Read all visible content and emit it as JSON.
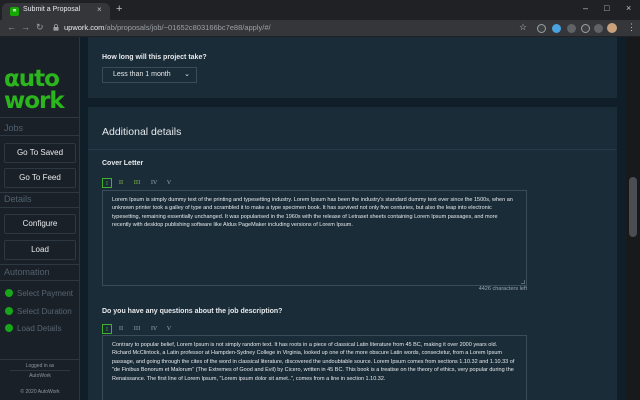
{
  "browser": {
    "tab_title": "Submit a Proposal",
    "tab_close": "×",
    "new_tab": "+",
    "url_host": "upwork.com",
    "url_path": "/ab/proposals/job/~01652c803166bc7e88/apply/#/",
    "window_minimize": "–",
    "window_maximize": "□",
    "window_close": "×"
  },
  "sidebar": {
    "logo_line1": "αuto",
    "logo_line2": "work",
    "section_jobs": "Jobs",
    "go_to_saved": "Go To Saved",
    "go_to_feed": "Go To Feed",
    "section_details": "Details",
    "configure": "Configure",
    "load": "Load",
    "section_automation": "Automation",
    "automation_items": [
      "Select Payment",
      "Select Duration",
      "Load Details"
    ],
    "logged_in_as": "Logged in as",
    "username": "AutoWork",
    "copyright": "© 2020 AutoWork"
  },
  "main": {
    "duration_question": "How long will this project take?",
    "duration_value": "Less than 1 month",
    "additional_details": "Additional details",
    "cover_letter_label": "Cover Letter",
    "format_buttons": [
      "I",
      "II",
      "III",
      "IV",
      "V"
    ],
    "cover_letter_text": "Lorem Ipsum is simply dummy text of the printing and typesetting industry. Lorem Ipsum has been the industry's standard dummy text ever since the 1500s, when an unknown printer took a galley of type and scrambled it to make a type specimen book. It has survived not only five centuries, but also the leap into electronic typesetting, remaining essentially unchanged. It was popularised in the 1960s with the release of Letraset sheets containing Lorem Ipsum passages, and more recently with desktop publishing software like Aldus PageMaker including versions of Lorem Ipsum.",
    "characters_left": "4426 characters left",
    "questions_label": "Do you have any questions about the job description?",
    "questions_text": "Contrary to popular belief, Lorem Ipsum is not simply random text. It has roots in a piece of classical Latin literature from 45 BC, making it over 2000 years old. Richard McClintock, a Latin professor at Hampden-Sydney College in Virginia, looked up one of the more obscure Latin words, consectetur, from a Lorem Ipsum passage, and going through the cites of the word in classical literature, discovered the undoubtable source. Lorem Ipsum comes from sections 1.10.32 and 1.10.33 of \"de Finibus Bonorum et Malorum\" (The Extremes of Good and Evil) by Cicero, written in 45 BC. This book is a treatise on the theory of ethics, very popular during the Renaissance. The first line of Lorem Ipsum, \"Lorem ipsum dolor sit amet..\", comes from a line in section 1.10.32."
  },
  "colors": {
    "brand_green": "#2bb61e",
    "page_bg": "#0f1e28",
    "card_bg": "#1a2c38",
    "sidebar_bg": "#1a2027"
  }
}
